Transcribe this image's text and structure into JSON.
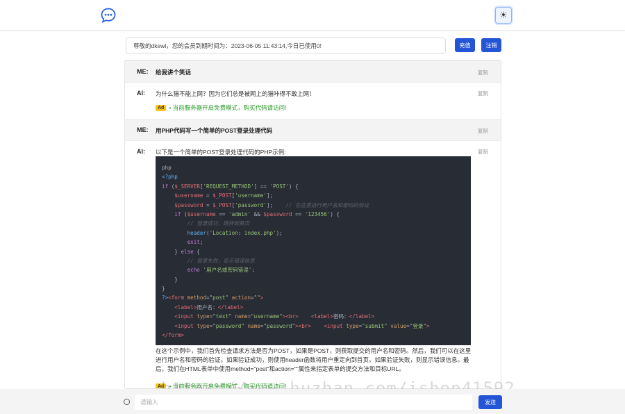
{
  "header": {
    "logo_icon": "chat-bubble-icon",
    "theme_icon": "sun-icon",
    "theme_glyph": "☀"
  },
  "notice": {
    "text": "尊敬的dkewl，您的会员到期时间为：2023-06-05 11:43:14,今日已使用0!",
    "recharge_label": "充值",
    "logout_label": "注销"
  },
  "messages": [
    {
      "role": "ME:",
      "text": "给我讲个笑话",
      "copy": "复制"
    },
    {
      "role": "AI:",
      "text": "为什么猫不能上网？因为它们总是被网上的猫咔得不敢上网！",
      "copy": "复制",
      "ad_badge": "Ad",
      "ad_text": "• 当前服务器开启免费模式，购买代码请访问!"
    },
    {
      "role": "ME:",
      "text": "用PHP代码写一个简单的POST登录处理代码",
      "copy": "复制"
    },
    {
      "role": "AI:",
      "text": "以下是一个简单的POST登录处理代码的PHP示例:",
      "copy": "复制",
      "code_lang": "php",
      "explanation": "在这个示例中，我们首先检查请求方法是否为POST，如果是POST，则获取提交的用户名和密码。然后，我们可以在这里进行用户名和密码的验证。如果验证成功，则使用header函数将用户重定向到首页。如果验证失败，则显示错误信息。最后，我们在HTML表单中使用method=\"post\"和action=\"\"属性来指定表单的提交方法和目标URL。",
      "ad_badge": "Ad",
      "ad_text": "• 当前服务器开启免费模式，购买代码请访问!"
    }
  ],
  "input": {
    "placeholder": "请输入",
    "value": ""
  },
  "send_label": "发送",
  "watermark": "https://www.huzhan.com/ishop41592",
  "colors": {
    "primary": "#2455d6",
    "code_bg": "#282c34",
    "ad_green": "#2b9a2b",
    "ad_badge": "#f5c518"
  }
}
